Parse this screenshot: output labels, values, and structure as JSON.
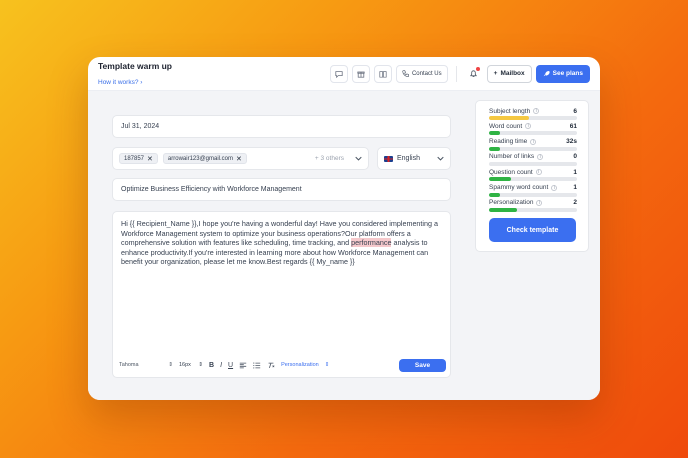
{
  "header": {
    "title": "Template warm up",
    "how_link": "How it works?",
    "how_chevron": "›",
    "contact_label": "Contact Us",
    "mailbox_label": "Mailbox",
    "mailbox_plus": "+",
    "plans_label": "See plans",
    "icons": [
      "chat-icon",
      "gift-icon",
      "book-icon",
      "phone-icon",
      "bell-icon"
    ]
  },
  "editor": {
    "date": "Jul 31, 2024",
    "recipients": [
      {
        "label": "187857",
        "remove": "✕"
      },
      {
        "label": "arrowair123@gmail.com",
        "remove": "✕"
      }
    ],
    "others": "+ 3 others",
    "language": "English",
    "subject": "Optimize Business Efficiency with Workforce Management",
    "body_part1": "Hi {{ Recipient_Name }},I hope you're having a wonderful day! Have you considered implementing a Workforce Management system to optimize your business operations?Our platform offers a comprehensive solution with features like scheduling, time tracking, and ",
    "body_highlight": "performance",
    "body_part2": " analysis to enhance productivity.If you're interested in learning more about how Workforce Management can benefit your organization, please let me know.Best regards {{ My_name }}"
  },
  "toolbar": {
    "font": "Tahoma",
    "size": "16px",
    "bold": "B",
    "italic": "I",
    "underline": "U",
    "personalization": "Personalization",
    "save_label": "Save"
  },
  "stats": {
    "items": [
      {
        "label": "Subject length",
        "value": "6",
        "fill": 0.45,
        "color": "#f5c842"
      },
      {
        "label": "Word count",
        "value": "61",
        "fill": 0.12,
        "color": "#2fb344"
      },
      {
        "label": "Reading time",
        "value": "32s",
        "fill": 0.12,
        "color": "#2fb344"
      },
      {
        "label": "Number of links",
        "value": "0",
        "fill": 0.0,
        "color": "#2fb344"
      },
      {
        "label": "Question count",
        "value": "1",
        "fill": 0.25,
        "color": "#2fb344"
      },
      {
        "label": "Spammy word count",
        "value": "1",
        "fill": 0.12,
        "color": "#2fb344"
      },
      {
        "label": "Personalization",
        "value": "2",
        "fill": 0.32,
        "color": "#2fb344"
      }
    ],
    "check_label": "Check template"
  }
}
